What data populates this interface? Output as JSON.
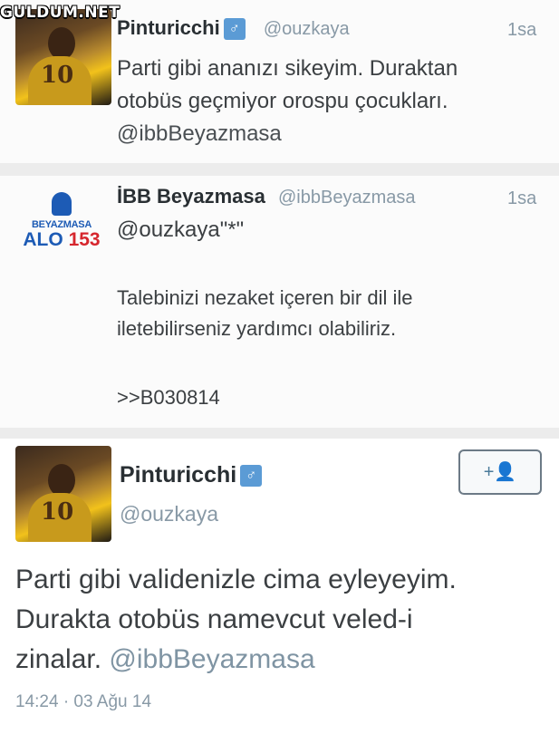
{
  "watermark": "GULDUM.NET",
  "tweets": [
    {
      "name": "Pinturicchi",
      "handle": "@ouzkaya",
      "time": "1sa",
      "lines": [
        "Parti gibi ananızı sikeyim. Duraktan",
        "otobüs geçmiyor orospu çocukları."
      ],
      "mention": "@ibbBeyazmasa"
    },
    {
      "name": "İBB Beyazmasa",
      "handle": "@ibbBeyazmasa",
      "time": "1sa",
      "reply_to": "@ouzkaya\"*\"",
      "lines": [
        "Talebinizi nezaket içeren bir dil ile",
        "iletebilirseniz yardımcı olabiliriz."
      ],
      "ref": ">>B030814",
      "logo": {
        "top": "BEYAZMASA",
        "alo": "ALO",
        "num": "153"
      }
    },
    {
      "name": "Pinturicchi",
      "handle": "@ouzkaya",
      "lines": [
        "Parti gibi validenizle cima eyleyeyim.",
        "Durakta otobüs namevcut veled-i"
      ],
      "last_line": "zinalar.",
      "mention": "@ibbBeyazmasa",
      "timestamp": "14:24 · 03 Ağu 14",
      "follow_label": "+👤"
    }
  ],
  "icons": {
    "gender": "♂",
    "avatar": "jersey-number-10"
  },
  "colors": {
    "handle": "#8899a6",
    "logo_blue": "#1d5bb5",
    "logo_red": "#d6262d"
  }
}
